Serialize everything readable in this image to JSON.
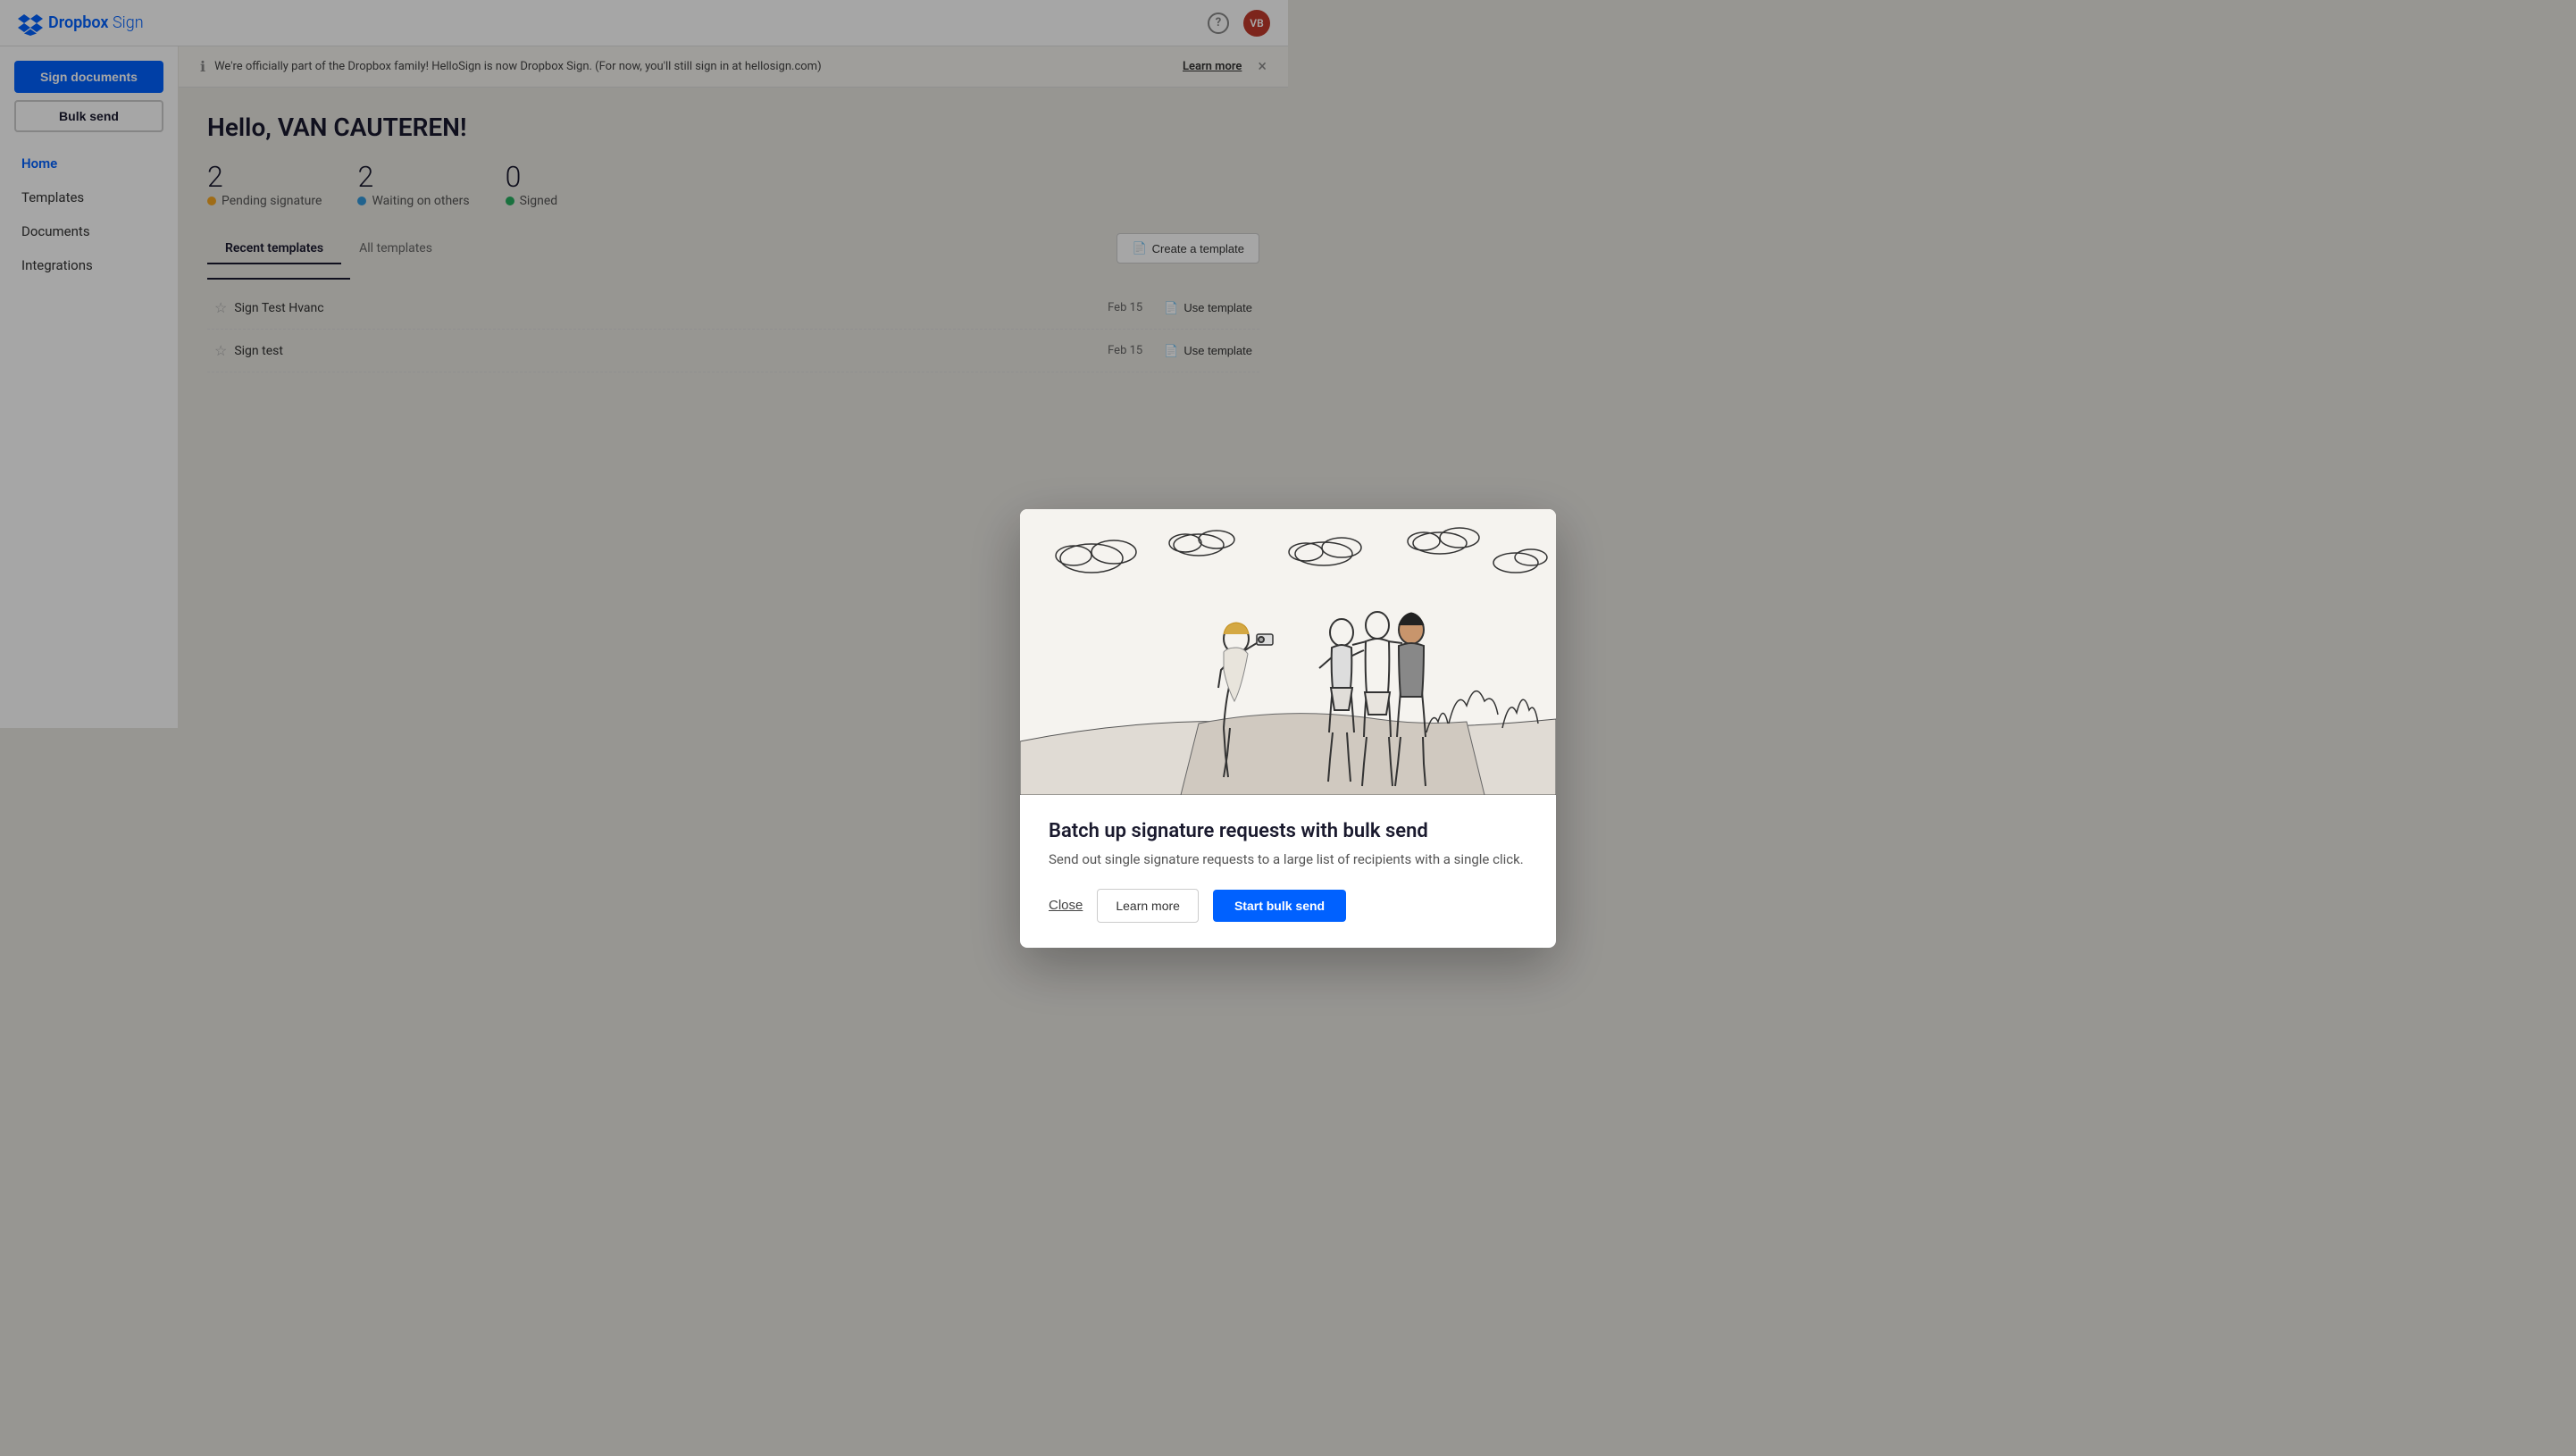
{
  "app": {
    "name": "Dropbox",
    "name_suffix": "Sign",
    "logo_alt": "Dropbox Sign"
  },
  "topnav": {
    "help_label": "?",
    "avatar_initials": "VB"
  },
  "banner": {
    "message": "We're officially part of the Dropbox family! HelloSign is now Dropbox Sign. (For now, you'll still sign in at hellosign.com)",
    "learn_more_label": "Learn more",
    "close_label": "×"
  },
  "sidebar": {
    "sign_docs_label": "Sign documents",
    "bulk_send_label": "Bulk send",
    "nav_items": [
      {
        "id": "home",
        "label": "Home"
      },
      {
        "id": "templates",
        "label": "Templates"
      },
      {
        "id": "documents",
        "label": "Documents"
      },
      {
        "id": "integrations",
        "label": "Integrations"
      }
    ]
  },
  "page": {
    "greeting": "Hello, VAN CAUTEREN!",
    "stats": [
      {
        "id": "pending",
        "number": "2",
        "label": "Pending signature",
        "dot": "yellow"
      },
      {
        "id": "waiting",
        "number": "2",
        "label": "Waiting on others",
        "dot": "blue"
      },
      {
        "id": "signed",
        "number": "0",
        "label": "Signed",
        "dot": "green"
      }
    ]
  },
  "templates_section": {
    "tabs": [
      {
        "id": "recent",
        "label": "Recent templates",
        "active": true
      },
      {
        "id": "all",
        "label": "All templates",
        "active": false
      }
    ],
    "create_button_label": "Create a template",
    "template_icon_label": "📄",
    "rows": [
      {
        "id": "row1",
        "star_label": "☆",
        "name": "Sign Test Hvanc",
        "date": "Feb 15",
        "action_label": "Use template"
      },
      {
        "id": "row2",
        "star_label": "☆",
        "name": "Sign test",
        "date": "Feb 15",
        "action_label": "Use template"
      }
    ]
  },
  "modal": {
    "title": "Batch up signature requests with bulk send",
    "description": "Send out single signature requests to a large list of recipients with a single click.",
    "close_label": "Close",
    "learn_more_label": "Learn more",
    "start_bulk_label": "Start bulk send"
  }
}
